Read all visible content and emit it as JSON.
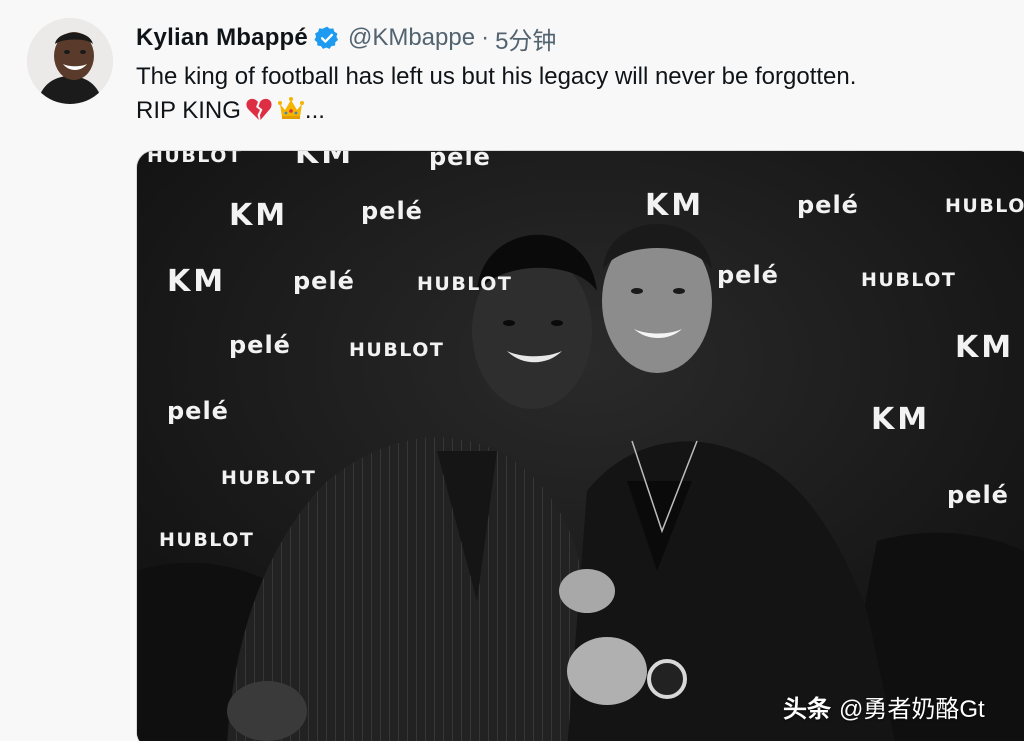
{
  "author": {
    "display_name": "Kylian Mbappé",
    "handle": "@KMbappe",
    "separator": "·",
    "time_ago": "5分钟",
    "verified": true
  },
  "tweet": {
    "line1": "The king of football has left us but his legacy will never be forgotten.",
    "line2_text": "RIP KING",
    "line2_suffix": "...",
    "emojis": [
      "broken-heart-icon",
      "crown-icon"
    ]
  },
  "media": {
    "backdrop_logos": {
      "hublot": "HUBLOT",
      "km": "KM",
      "pele": "pelé"
    }
  },
  "watermark": {
    "brand": "头条",
    "account": "@勇者奶酪Gt"
  },
  "colors": {
    "verified_blue": "#1d9bf0",
    "handle_gray": "#536471",
    "text": "#0f1419"
  }
}
